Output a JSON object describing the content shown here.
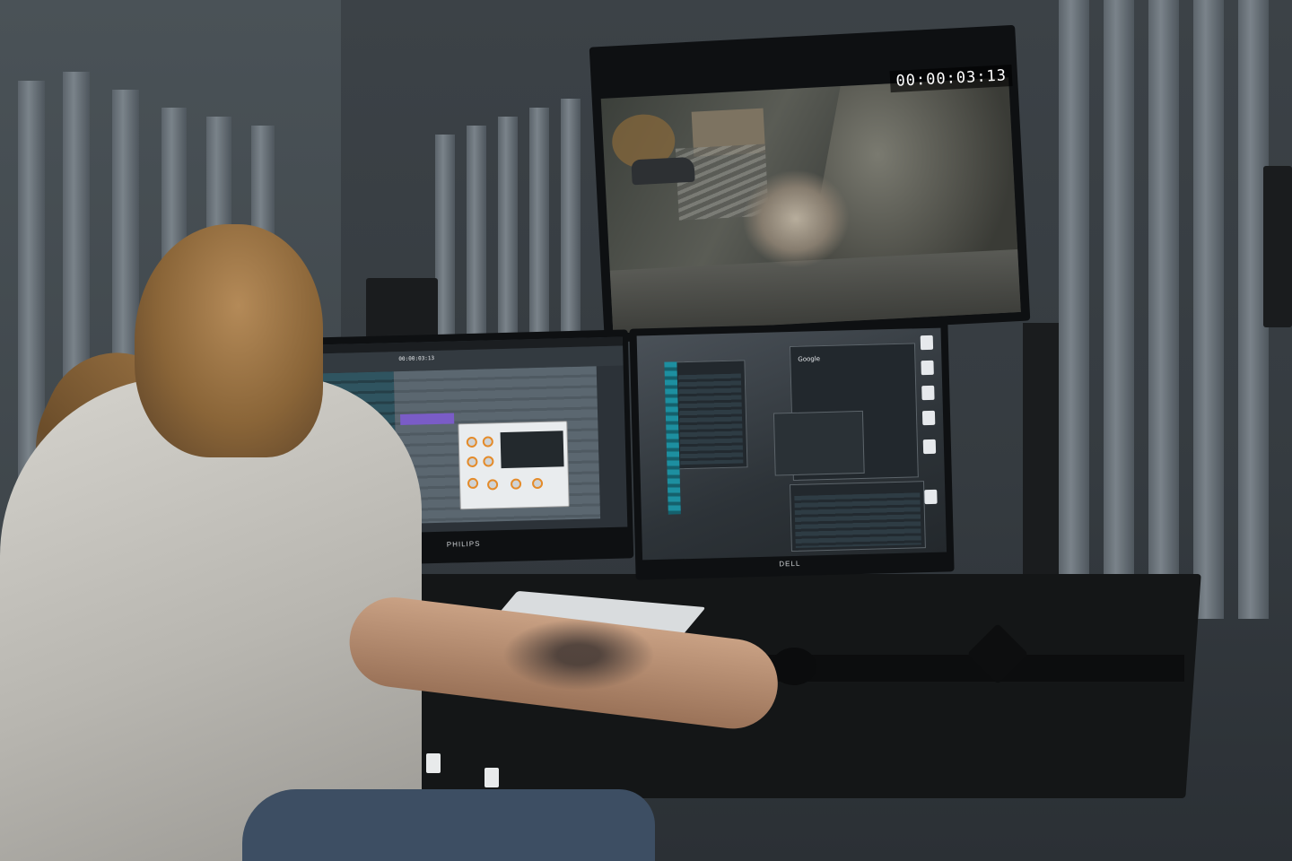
{
  "scene": {
    "description_id": "video-editing-studio",
    "tv": {
      "timecode": "00:00:03:13"
    },
    "daw_monitor": {
      "brand": "PHILIPS",
      "daw_timecode": "00:00:03:13"
    },
    "side_monitor": {
      "brand": "DELL",
      "browser": {
        "search_brand": "Google"
      }
    }
  }
}
